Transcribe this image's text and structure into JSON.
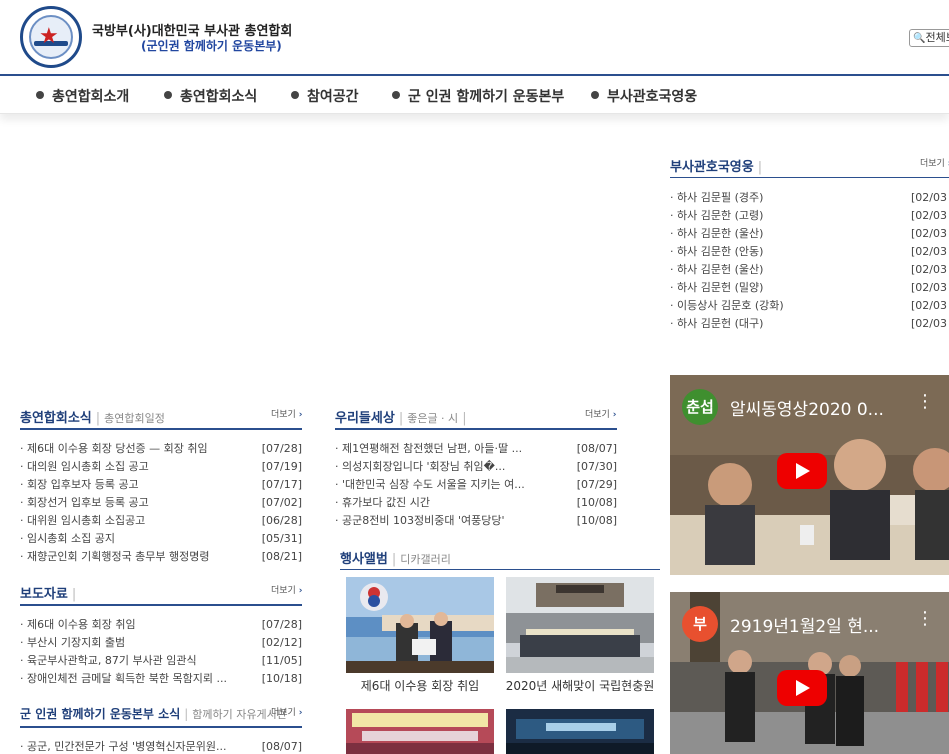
{
  "header": {
    "org_line1": "국방부(사)대한민국 부사관 총연합회",
    "org_line2": "(군인권 함께하기 운동본부)",
    "search_label": "전체보"
  },
  "nav": [
    {
      "label": "총연합회소개"
    },
    {
      "label": "총연합회소식"
    },
    {
      "label": "참여공간"
    },
    {
      "label": "군 인권 함께하기 운동본부"
    },
    {
      "label": "부사관호국영웅"
    }
  ],
  "more_label": "더보기",
  "heroes": {
    "title": "부사관호국영웅",
    "items": [
      {
        "text": "· 하사 김문필 (경주)",
        "date": "[02/03"
      },
      {
        "text": "· 하사 김문한 (고령)",
        "date": "[02/03"
      },
      {
        "text": "· 하사 김문한 (울산)",
        "date": "[02/03"
      },
      {
        "text": "· 하사 김문한 (안동)",
        "date": "[02/03"
      },
      {
        "text": "· 하사 김문헌 (울산)",
        "date": "[02/03"
      },
      {
        "text": "· 하사 김문헌 (밀양)",
        "date": "[02/03"
      },
      {
        "text": "· 이등상사 김문호 (강화)",
        "date": "[02/03"
      },
      {
        "text": "· 하사 김문헌 (대구)",
        "date": "[02/03"
      }
    ]
  },
  "news": {
    "title": "총연합회소식",
    "sub": "총연합회일정",
    "items": [
      {
        "text": "· 제6대 이수용 회장 당선증 — 회장 취임",
        "date": "[07/28]"
      },
      {
        "text": "· 대의원 임시총회 소집 공고",
        "date": "[07/19]"
      },
      {
        "text": "· 회장 입후보자 등록 공고",
        "date": "[07/17]"
      },
      {
        "text": "· 회장선거 입후보 등록 공고",
        "date": "[07/02]"
      },
      {
        "text": "· 대위원 임시총회 소집공고",
        "date": "[06/28]"
      },
      {
        "text": "· 임시총회 소집 공지",
        "date": "[05/31]"
      },
      {
        "text": "· 재향군인회 기획행정국 총무부 행정명령",
        "date": "[08/21]"
      }
    ]
  },
  "press": {
    "title": "보도자료",
    "items": [
      {
        "text": "· 제6대 이수용 회장 취임",
        "date": "[07/28]"
      },
      {
        "text": "· 부산시 기장지회 출범",
        "date": "[02/12]"
      },
      {
        "text": "· 육군부사관학교, 87기 부사관 임관식",
        "date": "[11/05]"
      },
      {
        "text": "· 장애인체전 금메달 획득한 북한 목함지뢰 ...",
        "date": "[10/18]"
      }
    ]
  },
  "rights": {
    "title": "군 인권 함께하기 운동본부 소식",
    "sub": "함께하기 자유게시판",
    "items": [
      {
        "text": "· 공군, 민간전문가 구성 '병영혁신자문위원...",
        "date": "[08/07]"
      }
    ]
  },
  "world": {
    "title": "우리들세상",
    "sub": "좋은글 · 시",
    "items": [
      {
        "text": "· 제1연평해전 참전했던 남편, 아들·딸 ...",
        "date": "[08/07]"
      },
      {
        "text": "· 의성지회장입니다 '회장님 취임�...",
        "date": "[07/30]"
      },
      {
        "text": "· '대한민국 심장 수도 서울을 지키는 여...",
        "date": "[07/29]"
      },
      {
        "text": "· 휴가보다 값진 시간",
        "date": "[10/08]"
      },
      {
        "text": "· 공군8전비 103정비중대 '여풍당당'",
        "date": "[10/08]"
      }
    ]
  },
  "album": {
    "title": "행사앨범",
    "sub": "디카갤러리",
    "items": [
      {
        "caption": "제6대 이수용 회장 취임"
      },
      {
        "caption": "2020년 새해맞이 국립현충원"
      }
    ]
  },
  "videos": [
    {
      "icon_char": "춘섭",
      "title": "알씨동영상2020 0...",
      "icon_color": "#3f8f2f"
    },
    {
      "icon_char": "부",
      "title": "2919년1월2일 현...",
      "icon_color": "#e8502f"
    }
  ]
}
